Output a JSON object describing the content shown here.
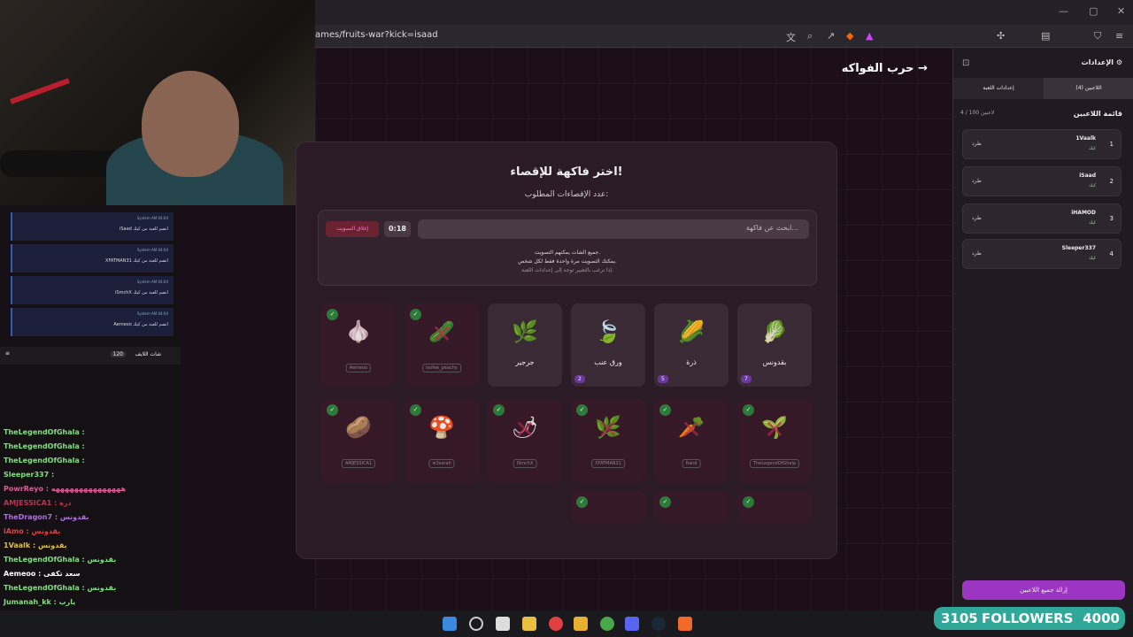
{
  "browser": {
    "url": "ames/fruits-war?kick=isaad"
  },
  "game": {
    "back_title": "حرب الفواكه",
    "card_title": "اختر فاكهة للإقصاء!",
    "card_sub": "عدد الإقصاءات المطلوب:",
    "search_placeholder": "ابحث عن فاكهة...",
    "timer": "0:18",
    "close_vote": "إغلاق التصويت",
    "note1": "جميع الشات يمكنهم التصويت.",
    "note2": "يمكنك التصويت مرة واحدة فقط لكل شخص.",
    "note3": "إذا ترغب بالتغيير توجه إلى إعدادات اللعبة.",
    "fruits": [
      {
        "name": "بقدونس",
        "icon": "🥬",
        "votes": "7",
        "dead": false
      },
      {
        "name": "ذرة",
        "icon": "🌽",
        "votes": "5",
        "dead": false
      },
      {
        "name": "ورق عنب",
        "icon": "🍃",
        "votes": "2",
        "dead": false
      },
      {
        "name": "جرجير",
        "icon": "🌿",
        "votes": "",
        "dead": false
      },
      {
        "name": "",
        "icon": "🥒",
        "tag": "isofee_peachy",
        "dead": true
      },
      {
        "name": "",
        "icon": "🧄",
        "tag": "Aemeoo",
        "dead": true
      }
    ],
    "dead_row2": [
      "TheLegendOfGhala",
      "Rand",
      "XFATMAN31",
      "iSmchX",
      "w3sarah",
      "AMJESSICA1"
    ]
  },
  "sidebar": {
    "header": "الإعدادات",
    "tab_players": "اللاعبين (4)",
    "tab_settings": "إعدادات اللعبة",
    "list_title": "قائمة اللاعبين",
    "count": "4 / 100 لاعبين",
    "kick_label": "طرد",
    "status_label": "كيك",
    "players": [
      {
        "num": "1",
        "name": "1Vaalk"
      },
      {
        "num": "2",
        "name": "iSaad"
      },
      {
        "num": "3",
        "name": "iHAMOD"
      },
      {
        "num": "4",
        "name": "Sleeper337"
      }
    ],
    "remove_all": "إزالة جميع اللاعبين"
  },
  "chat": {
    "system": [
      {
        "meta": "System AM 04:04",
        "text": "iSaad انضم للعبة من كيك"
      },
      {
        "meta": "System AM 04:04",
        "text": "XFATMAN31 انضم للعبة من كيك"
      },
      {
        "meta": "System AM 04:04",
        "text": "iSmchX انضم للعبة من كيك"
      },
      {
        "meta": "System AM 04:04",
        "text": "Aemeoo انضم للعبة من كيك"
      }
    ],
    "live_label": "شات اللايف",
    "live_count": "120",
    "lines": [
      {
        "text": "TheLegendOfGhala :",
        "color": "#7fe07f"
      },
      {
        "text": "TheLegendOfGhala :",
        "color": "#7fe07f"
      },
      {
        "text": "TheLegendOfGhala :",
        "color": "#7fe07f"
      },
      {
        "text": "Sleeper337 :",
        "color": "#7fe07f"
      },
      {
        "text": "PowrReyo : هههههههههههههههه",
        "color": "#e05a9a"
      },
      {
        "text": "AMJESSICA1 : ذرة",
        "color": "#c03050"
      },
      {
        "text": "TheDragon7 : بقدونس",
        "color": "#b070e0"
      },
      {
        "text": "iAmo : بقدونس",
        "color": "#e04040"
      },
      {
        "text": "1Vaalk : بقدونس",
        "color": "#e0c040"
      },
      {
        "text": "TheLegendOfGhala : بقدونس",
        "color": "#7fe07f"
      },
      {
        "text": "Aemeoo : سعد تكفى",
        "color": "#ffffff"
      },
      {
        "text": "TheLegendOfGhala : بقدونس",
        "color": "#7fe07f"
      },
      {
        "text": "Jumanah_kk : يارب",
        "color": "#7fe07f"
      }
    ]
  },
  "overlay": {
    "followers": "3105",
    "followers_label": "FOLLOWERS",
    "goal": "4000"
  }
}
